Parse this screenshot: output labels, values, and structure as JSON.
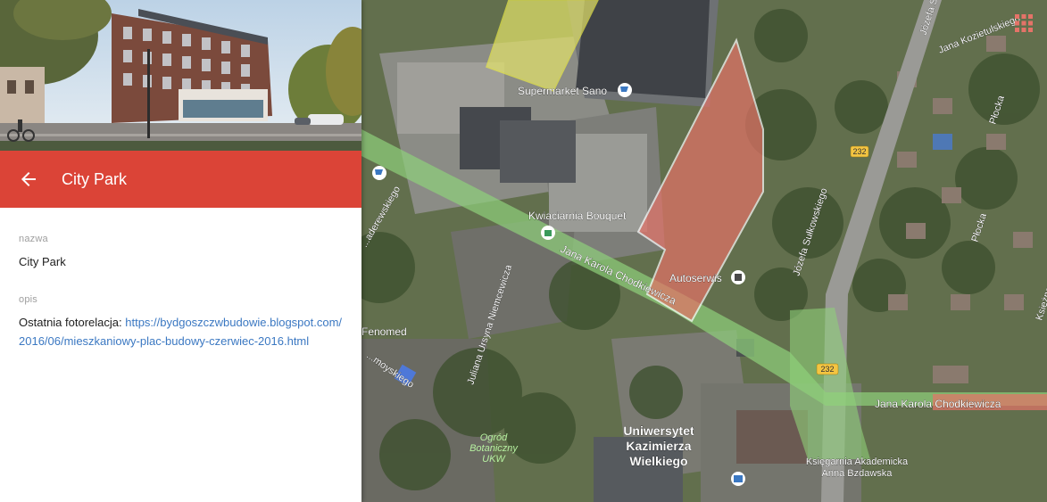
{
  "colors": {
    "accent": "#DB4437",
    "link": "#3B78C2",
    "highlight_red": "#E57368",
    "highlight_yellow": "#E4E46A",
    "highlight_green": "#8FD07A",
    "road_shield": "#F4C542"
  },
  "panel": {
    "title": "City Park",
    "back_icon": "arrow-left-icon",
    "fields": [
      {
        "label": "nazwa",
        "value": "City Park"
      },
      {
        "label": "opis",
        "value_prefix": "Ostatnia fotorelacja: ",
        "link_text": "https://bydgoszczwbudowie.blogspot.com/2016/06/mieszkaniowy-plac-budowy-czerwiec-2016.html"
      }
    ]
  },
  "map": {
    "labels": {
      "supermarket": "Supermarket Sano",
      "florist": "Kwiaciarnia Bouquet",
      "autoserwis": "Autoserwis",
      "fenomed": "Fenomed",
      "university": "Uniwersytet Kazimierza Wielkiego",
      "bookstore": "Księgarnia Akademicka Anna Bzdawska",
      "garden": "Ogród Botaniczny UKW",
      "street_chodkiewicza_1": "Jana Karola Chodkiewicza",
      "street_chodkiewicza_2": "Jana Karola Chodkiewicza",
      "street_sulkowskiego_1": "Józefa Sułkowskiego",
      "street_sulkowskiego_2": "Józefa Su",
      "street_kozietulskiego": "Jana Kozietulskiego",
      "street_plocka_1": "Płocka",
      "street_plocka_2": "Płocka",
      "street_ksiezna": "Księżna",
      "street_paderewskiego": "...aderewskiego",
      "street_niemcewicza": "Juliana Ursyna Niemcewicza",
      "street_moyskiego": "...moyskiego",
      "road_232_a": "232",
      "road_232_b": "232"
    },
    "grid_icon": "apps-grid-icon"
  }
}
